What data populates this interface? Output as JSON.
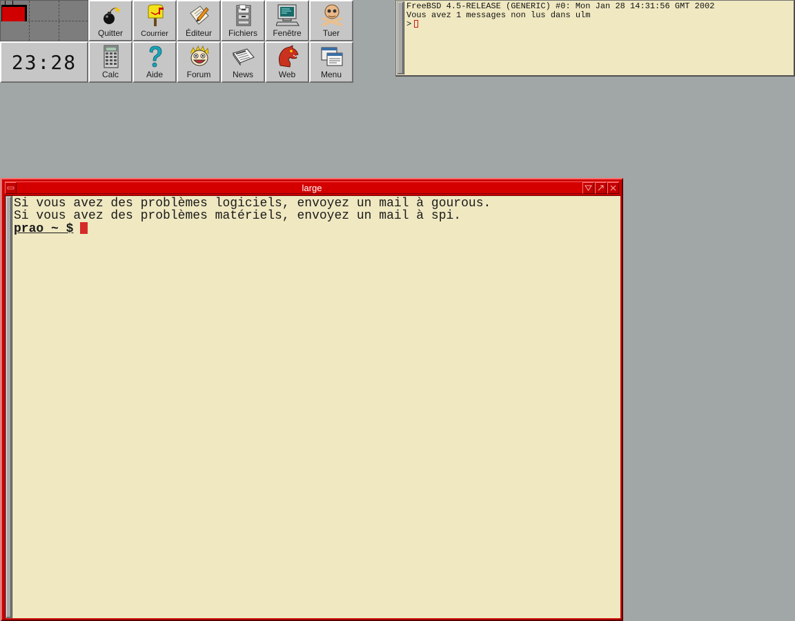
{
  "clock": {
    "time": "23:28"
  },
  "buttons": [
    {
      "id": "quitter",
      "label": "Quitter",
      "icon": "bomb-icon"
    },
    {
      "id": "courrier",
      "label": "Courrier",
      "icon": "mailbox-icon"
    },
    {
      "id": "editeur",
      "label": "Éditeur",
      "icon": "notepad-pencil-icon"
    },
    {
      "id": "fichiers",
      "label": "Fichiers",
      "icon": "file-cabinet-icon"
    },
    {
      "id": "fenetre",
      "label": "Fenêtre",
      "icon": "computer-terminal-icon"
    },
    {
      "id": "tuer",
      "label": "Tuer",
      "icon": "skull-crossbones-icon"
    },
    {
      "id": "calc",
      "label": "Calc",
      "icon": "calculator-icon"
    },
    {
      "id": "aide",
      "label": "Aide",
      "icon": "question-mark-icon"
    },
    {
      "id": "forum",
      "label": "Forum",
      "icon": "cartoon-face-icon"
    },
    {
      "id": "news",
      "label": "News",
      "icon": "newspaper-icon"
    },
    {
      "id": "web",
      "label": "Web",
      "icon": "mozilla-dino-icon"
    },
    {
      "id": "menu",
      "label": "Menu",
      "icon": "windows-menu-icon"
    }
  ],
  "small_terminal": {
    "lines": [
      "FreeBSD 4.5-RELEASE (GENERIC) #0: Mon Jan 28 14:31:56 GMT 2002",
      "Vous avez 1 messages non lus dans ulm"
    ],
    "prompt": ">"
  },
  "large_terminal": {
    "title": "large",
    "lines": [
      "Si vous avez des problèmes logiciels, envoyez un mail à gourous.",
      "Si vous avez des problèmes matériels, envoyez un mail à spi."
    ],
    "prompt": "prao ~ $"
  },
  "colors": {
    "desktop": "#a1a6a6",
    "terminal_bg": "#efe8c1",
    "window_frame": "#cc0000",
    "cursor": "#d42a2a"
  }
}
